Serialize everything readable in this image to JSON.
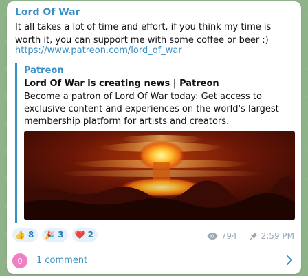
{
  "post": {
    "channel_name": "Lord Of War",
    "text": "It all takes a lot of time and effort, if you think my time is worth it, you can support me with some coffee or beer :)",
    "link": "https://www.patreon.com/lord_of_war"
  },
  "preview": {
    "site_name": "Patreon",
    "title": "Lord Of War is creating news | Patreon",
    "description": "Become a patron of Lord Of War today: Get access to exclusive content and experiences on the world's largest membership platform for artists and creators."
  },
  "reactions": [
    {
      "emoji": "👍",
      "count": "8"
    },
    {
      "emoji": "🎉",
      "count": "3"
    },
    {
      "emoji": "❤️",
      "count": "2"
    }
  ],
  "meta": {
    "views": "794",
    "time": "2:59 PM",
    "views_icon": "eye-icon",
    "pin_icon": "pin-icon"
  },
  "comments": {
    "avatar_letter": "0",
    "label": "1 comment"
  },
  "colors": {
    "accent": "#3a8fc5",
    "background": "#8fb389"
  }
}
